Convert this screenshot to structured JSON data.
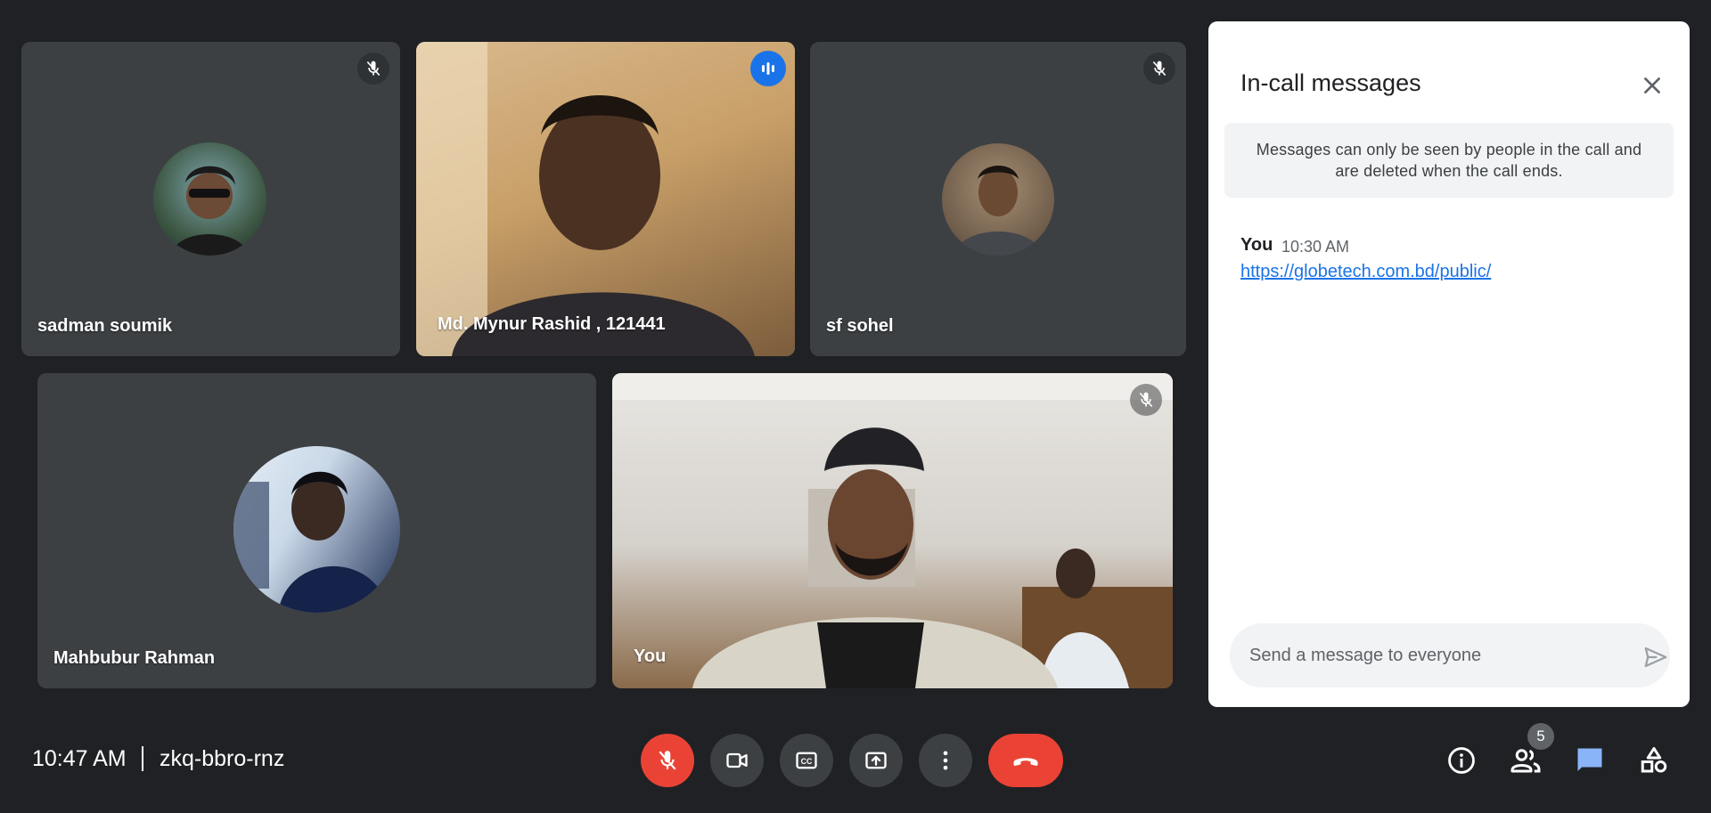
{
  "participants": [
    {
      "name": "sadman soumik",
      "muted": true
    },
    {
      "name": "Md. Mynur Rashid , 121441",
      "speaking": true
    },
    {
      "name": "sf sohel",
      "muted": true
    },
    {
      "name": "Mahbubur Rahman"
    },
    {
      "name": "You",
      "muted": true
    }
  ],
  "chat": {
    "title": "In-call messages",
    "notice": "Messages can only be seen by people in the call and are deleted when the call ends.",
    "messages": [
      {
        "sender": "You",
        "time": "10:30 AM",
        "text": "https://globetech.com.bd/public/"
      }
    ],
    "input_placeholder": "Send a message to everyone"
  },
  "bottom_bar": {
    "time": "10:47 AM",
    "meeting_code": "zkq-bbro-rnz",
    "people_count": "5"
  },
  "colors": {
    "background": "#202124",
    "tile": "#3c4043",
    "accent": "#8ab4f8",
    "danger": "#ea4335",
    "link": "#1a73e8"
  }
}
